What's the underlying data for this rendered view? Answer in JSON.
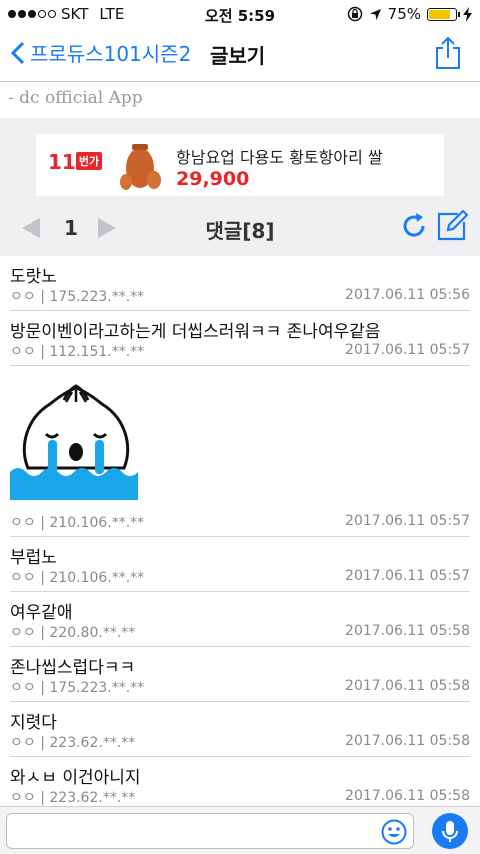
{
  "status": {
    "carrier": "SKT",
    "network": "LTE",
    "time": "오전 5:59",
    "battery": "75%",
    "signal_bars_filled": 3,
    "signal_bars_total": 5
  },
  "nav": {
    "back_label": "프로듀스101시즌2",
    "title": "글보기"
  },
  "app_caption": "- dc official App",
  "ad": {
    "logo": "11",
    "logo_tag": "번가",
    "title": "항남요업 다용도 황토항아리 쌀",
    "price": "29,900"
  },
  "pager": {
    "page": "1",
    "title": "댓글[8]"
  },
  "comments": [
    {
      "text": "도랏노",
      "meta": "ㅇㅇ | 175.223.**.**",
      "date": "2017.06.11 05:56"
    },
    {
      "text": "방문이벤이라고하는게 더씹스러워ㅋㅋ 존나여우같음",
      "meta": "ㅇㅇ | 112.151.**.**",
      "date": "2017.06.11 05:57"
    },
    {
      "emoticon": "crying-dumpling",
      "meta": "ㅇㅇ | 210.106.**.**",
      "date": "2017.06.11 05:57"
    },
    {
      "text": "부럽노",
      "meta": "ㅇㅇ | 210.106.**.**",
      "date": "2017.06.11 05:57"
    },
    {
      "text": "여우같애",
      "meta": "ㅇㅇ | 220.80.**.**",
      "date": "2017.06.11 05:58"
    },
    {
      "text": "존나씹스럽다ㅋㅋ",
      "meta": "ㅇㅇ | 175.223.**.**",
      "date": "2017.06.11 05:58"
    },
    {
      "text": "지렷다",
      "meta": "ㅇㅇ | 223.62.**.**",
      "date": "2017.06.11 05:58"
    },
    {
      "text": "와ㅅㅂ 이건아니지",
      "meta": "ㅇㅇ | 223.62.**.**",
      "date": "2017.06.11 05:58"
    }
  ],
  "colors": {
    "accent": "#1a7cf5",
    "price": "#e8262a",
    "battery": "#f5c400"
  }
}
